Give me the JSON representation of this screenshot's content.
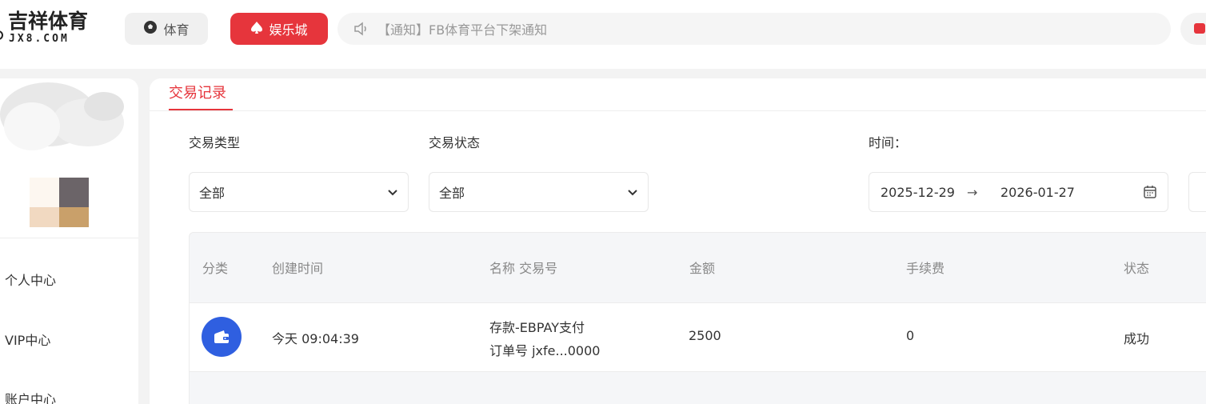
{
  "header": {
    "logo_title": "吉祥体育",
    "logo_sub": "JX8.COM",
    "nav": [
      {
        "label": "体育",
        "icon": "soccer-ball-icon"
      },
      {
        "label": "娱乐城",
        "icon": "spade-icon"
      }
    ],
    "notice_text": "【通知】FB体育平台下架通知",
    "accent_color": "#e6353c"
  },
  "sidebar": {
    "items": [
      {
        "label": "个人中心"
      },
      {
        "label": "VIP中心"
      },
      {
        "label": "账户中心"
      }
    ]
  },
  "main": {
    "tab_label": "交易记录",
    "filters": {
      "type_label": "交易类型",
      "type_value": "全部",
      "status_label": "交易状态",
      "status_value": "全部",
      "time_label": "时间：",
      "date_start": "2025-12-29",
      "date_arrow": "→",
      "date_end": "2026-01-27"
    },
    "table": {
      "columns": [
        "分类",
        "创建时间",
        "名称 交易号",
        "金额",
        "手续费",
        "状态"
      ],
      "rows": [
        {
          "icon": "wallet-icon",
          "time": "今天 09:04:39",
          "name": "存款-EBPAY支付",
          "order": "订单号 jxfe...0000",
          "amount": "2500",
          "fee": "0",
          "status": "成功"
        }
      ]
    }
  }
}
